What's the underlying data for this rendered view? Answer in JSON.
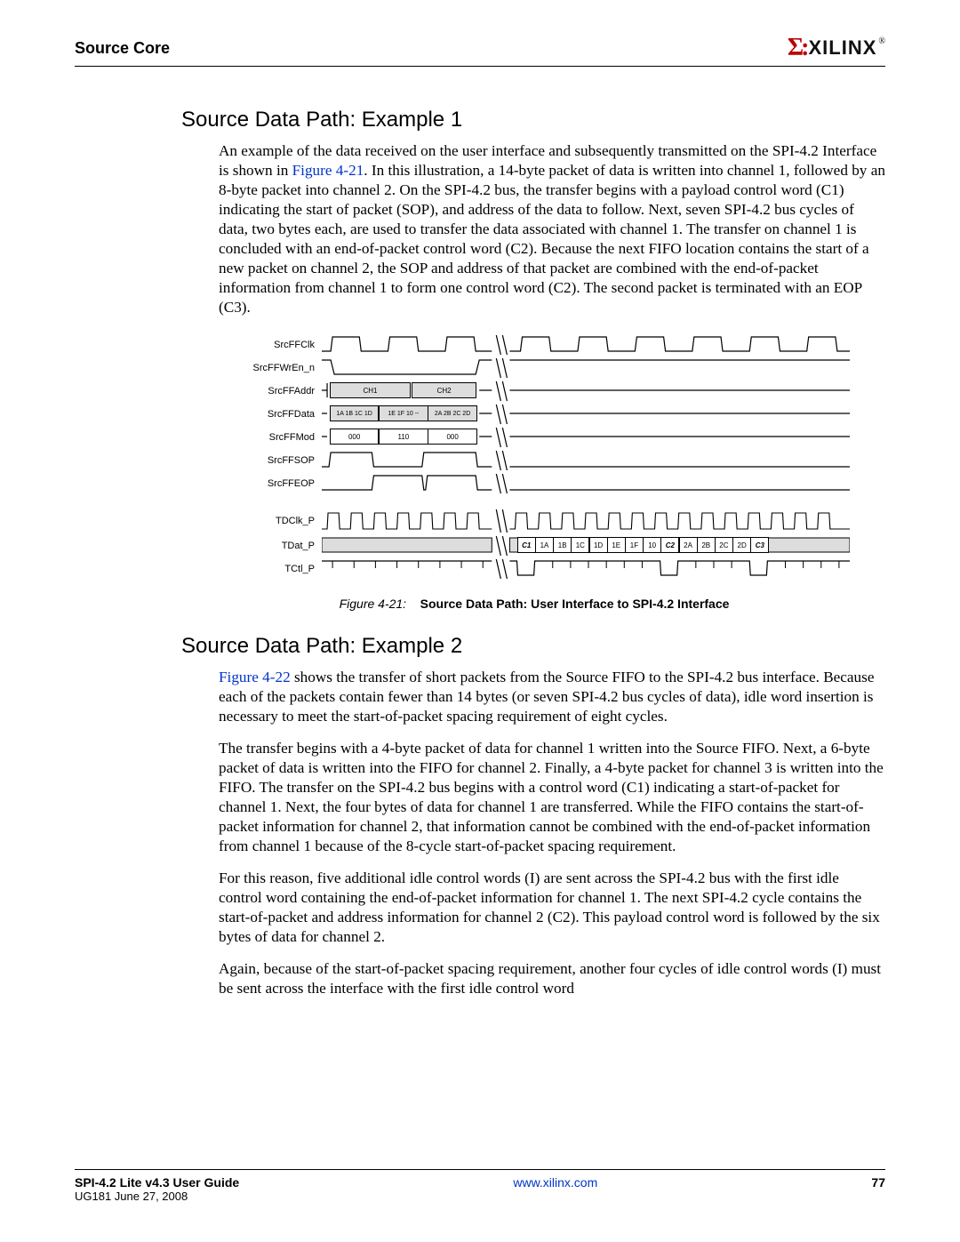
{
  "header": {
    "section": "Source Core",
    "logo_text": "XILINX",
    "logo_r": "®"
  },
  "section1": {
    "heading": "Source Data Path: Example 1",
    "para1a": "An example of the data received on the user interface and subsequently transmitted on the SPI-4.2 Interface is shown in ",
    "figlink1": "Figure 4-21",
    "para1b": ". In this illustration, a 14-byte packet of data is written into channel 1, followed by an 8-byte packet into channel 2. On the SPI-4.2 bus, the transfer begins with a payload control word (C1) indicating the start of packet (SOP), and address of the data to follow. Next, seven SPI-4.2 bus cycles of data, two bytes each, are used to transfer the data associated with channel 1. The transfer on channel 1 is concluded with an end-of-packet control word (C2). Because the next FIFO location contains the start of a new packet on channel 2, the SOP and address of that packet are combined with the end-of-packet information from channel 1 to form one control word (C2). The second packet is terminated with an EOP (C3)."
  },
  "figure": {
    "signals": {
      "s1": "SrcFFClk",
      "s2": "SrcFFWrEn_n",
      "s3": "SrcFFAddr",
      "s4": "SrcFFData",
      "s5": "SrcFFMod",
      "s6": "SrcFFSOP",
      "s7": "SrcFFEOP",
      "s8": "TDClk_P",
      "s9": "TDat_P",
      "s10": "TCtl_P"
    },
    "addr_boxes": {
      "ch1": "CH1",
      "ch2": "CH2"
    },
    "data_boxes": {
      "d1": "1A 1B 1C 1D",
      "d2": "1E 1F 10 --",
      "d3": "2A 2B 2C 2D"
    },
    "mod_boxes": {
      "m1": "000",
      "m2": "110",
      "m3": "000"
    },
    "tdat": {
      "c1": "C1",
      "d1a": "1A",
      "d1b": "1B",
      "d1c": "1C",
      "d1d": "1D",
      "d1e": "1E",
      "d1f": "1F",
      "d10": "10",
      "c2": "C2",
      "d2a": "2A",
      "d2b": "2B",
      "d2c": "2C",
      "d2d": "2D",
      "c3": "C3"
    },
    "caption_num": "Figure 4-21:",
    "caption_title": "Source Data Path: User Interface to SPI-4.2 Interface"
  },
  "section2": {
    "heading": "Source Data Path: Example 2",
    "figlink2": "Figure 4-22",
    "para1": " shows the transfer of short packets from the Source FIFO to the SPI-4.2 bus interface. Because each of the packets contain fewer than 14 bytes (or seven SPI-4.2 bus cycles of data), idle word insertion is necessary to meet the start-of-packet spacing requirement of eight cycles.",
    "para2": "The transfer begins with a 4-byte packet of data for channel 1 written into the Source FIFO. Next, a 6-byte packet of data is written into the FIFO for channel 2. Finally, a 4-byte packet for channel 3 is written into the FIFO. The transfer on the SPI-4.2 bus begins with a control word (C1) indicating a start-of-packet for channel 1. Next, the four bytes of data for channel 1 are transferred. While the FIFO contains the start-of-packet information for channel 2, that information cannot be combined with the end-of-packet information from channel 1 because of the 8-cycle start-of-packet spacing requirement.",
    "para3": "For this reason, five additional idle control words (I) are sent across the SPI-4.2 bus with the first idle control word containing the end-of-packet information for channel 1. The next SPI-4.2 cycle contains the start-of-packet and address information for channel 2 (C2). This payload control word is followed by the six bytes of data for channel 2.",
    "para4": "Again, because of the start-of-packet spacing requirement, another four cycles of idle control words (I) must be sent across the interface with the first idle control word"
  },
  "footer": {
    "title": "SPI-4.2 Lite v4.3 User Guide",
    "docid": "UG181 June 27, 2008",
    "url": "www.xilinx.com",
    "page": "77"
  }
}
